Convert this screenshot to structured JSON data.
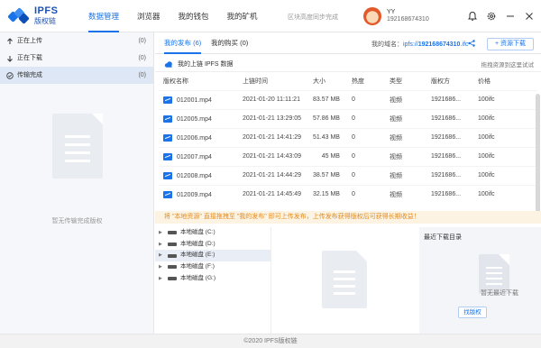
{
  "app": {
    "name": "IPFS",
    "subtitle": "版权链"
  },
  "nav": [
    {
      "label": "数据管理",
      "active": true
    },
    {
      "label": "浏览器",
      "active": false
    },
    {
      "label": "我的钱包",
      "active": false
    },
    {
      "label": "我的矿机",
      "active": false
    }
  ],
  "sync_status": "区块高度同步完成",
  "user": {
    "name": "YY",
    "id": "192168674310"
  },
  "top_icons": [
    "bell-icon",
    "gear-icon",
    "minimize-icon",
    "close-icon"
  ],
  "sidebar": {
    "items": [
      {
        "label": "正在上传",
        "count": "(0)"
      },
      {
        "label": "正在下载",
        "count": "(0)"
      },
      {
        "label": "传输完成",
        "count": "(0)"
      }
    ],
    "empty_text": "暂无传输完成版权"
  },
  "tabs": [
    {
      "label": "我的发布 (6)"
    },
    {
      "label": "我的购买 (0)"
    }
  ],
  "domain": {
    "label": "我的域名：",
    "prefix": "ipfs://",
    "value": "192168674310",
    "suffix": ".ifc"
  },
  "resource_button": "+ 资源下载",
  "subbar": {
    "title": "我的上链 IPFS 数据",
    "hint": "拖拽资源到这里试试"
  },
  "table": {
    "headers": [
      "版权名称",
      "上链时间",
      "大小",
      "热度",
      "类型",
      "版权方",
      "价格"
    ],
    "rows": [
      {
        "name": "012001.mp4",
        "time": "2021-01-20 11:11:21",
        "size": "83.57 MB",
        "heat": "0",
        "type": "视频",
        "owner": "1921686...",
        "price": "100ifc"
      },
      {
        "name": "012005.mp4",
        "time": "2021-01-21 13:29:05",
        "size": "57.86 MB",
        "heat": "0",
        "type": "视频",
        "owner": "1921686...",
        "price": "100ifc"
      },
      {
        "name": "012006.mp4",
        "time": "2021-01-21 14:41:29",
        "size": "51.43 MB",
        "heat": "0",
        "type": "视频",
        "owner": "1921686...",
        "price": "100ifc"
      },
      {
        "name": "012007.mp4",
        "time": "2021-01-21 14:43:09",
        "size": "45 MB",
        "heat": "0",
        "type": "视频",
        "owner": "1921686...",
        "price": "100ifc"
      },
      {
        "name": "012008.mp4",
        "time": "2021-01-21 14:44:29",
        "size": "38.57 MB",
        "heat": "0",
        "type": "视频",
        "owner": "1921686...",
        "price": "100ifc"
      },
      {
        "name": "012009.mp4",
        "time": "2021-01-21 14:45:49",
        "size": "32.15 MB",
        "heat": "0",
        "type": "视频",
        "owner": "1921686...",
        "price": "100ifc"
      }
    ]
  },
  "notice": "将 \"本地资源\" 直接拖拽至 \"我的发布\" 即可上传发布，上传发布获得版权后可获得长期收益！",
  "tree": [
    {
      "label": "本地磁盘 (C:)"
    },
    {
      "label": "本地磁盘 (D:)"
    },
    {
      "label": "本地磁盘 (E:)"
    },
    {
      "label": "本地磁盘 (F:)"
    },
    {
      "label": "本地磁盘 (G:)"
    }
  ],
  "recent": {
    "title": "最近下载目录",
    "empty": "暂无最近下载",
    "button": "找版权"
  },
  "footer": "©2020 IPFS版权链"
}
